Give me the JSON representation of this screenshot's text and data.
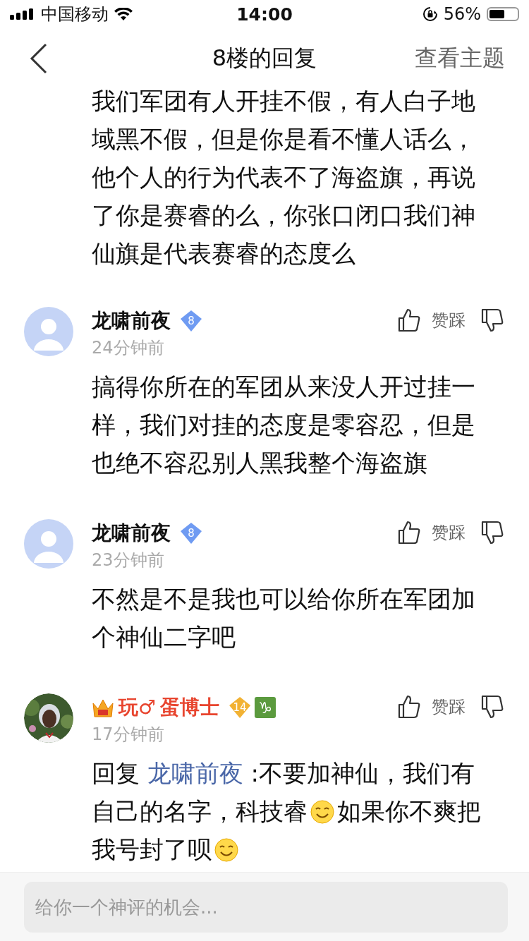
{
  "status_bar": {
    "carrier": "中国移动",
    "time": "14:00",
    "battery": "56%"
  },
  "nav": {
    "title": "8楼的回复",
    "action": "查看主题"
  },
  "lead_text": "我们军团有人开挂不假，有人白子地域黑不假，但是你是看不懂人话么，他个人的行为代表不了海盗旗，再说了你是赛睿的么，你张口闭口我们神仙旗是代表赛睿的态度么",
  "comments": [
    {
      "avatar_photo": false,
      "name": "龙啸前夜",
      "vip": false,
      "level": "8",
      "time": "24分钟前",
      "vote_label": "赞踩",
      "segments": [
        {
          "kind": "text",
          "text": "搞得你所在的军团从来没人开过挂一样，我们对挂的态度是零容忍，但是也绝不容忍别人黑我整个海盗旗"
        }
      ]
    },
    {
      "avatar_photo": false,
      "name": "龙啸前夜",
      "vip": false,
      "level": "8",
      "time": "23分钟前",
      "vote_label": "赞踩",
      "segments": [
        {
          "kind": "text",
          "text": "不然是不是我也可以给你所在军团加个神仙二字吧"
        }
      ]
    },
    {
      "avatar_photo": true,
      "name_prefix": "玩♂",
      "name": "蛋博士",
      "vip": true,
      "level": "14",
      "zodiac": "♑",
      "time": "17分钟前",
      "vote_label": "赞踩",
      "segments": [
        {
          "kind": "text",
          "text": "回复 "
        },
        {
          "kind": "mention",
          "text": "龙啸前夜"
        },
        {
          "kind": "text",
          "text": " :不要加神仙，我们有自己的名字，科技睿"
        },
        {
          "kind": "emoji"
        },
        {
          "kind": "text",
          "text": "如果你不爽把我号封了呗"
        },
        {
          "kind": "emoji"
        }
      ]
    }
  ],
  "composer": {
    "placeholder": "给你一个神评的机会..."
  }
}
